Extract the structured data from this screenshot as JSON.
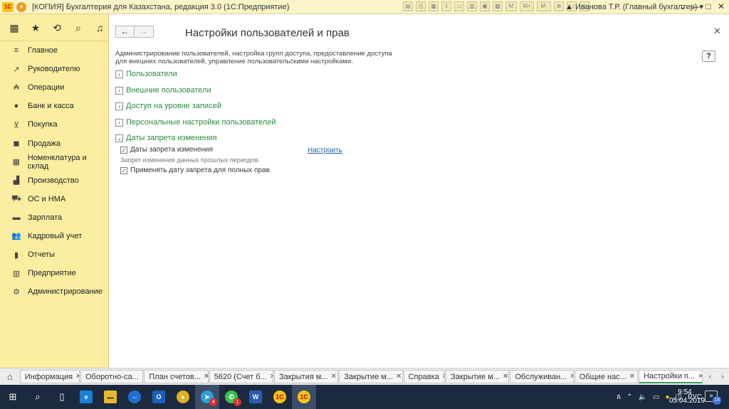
{
  "titlebar": {
    "logo": "1С",
    "title": "[КОПИЯ] Бухгалтерия для Казахстана, редакция 3.0  (1С:Предприятие)",
    "tools": [
      "M",
      "M+",
      "M-"
    ],
    "user": "Иванова Т.Р. (Главный бухгалтер)"
  },
  "sidebar": {
    "items": [
      {
        "label": "Главное",
        "icon": "menu-lines-icon"
      },
      {
        "label": "Руководителю",
        "icon": "trend-icon"
      },
      {
        "label": "Операции",
        "icon": "operations-icon"
      },
      {
        "label": "Банк и касса",
        "icon": "bank-icon"
      },
      {
        "label": "Покупка",
        "icon": "cart-icon"
      },
      {
        "label": "Продажа",
        "icon": "bag-icon"
      },
      {
        "label": "Номенклатура и склад",
        "icon": "warehouse-icon"
      },
      {
        "label": "Производство",
        "icon": "factory-icon"
      },
      {
        "label": "ОС и НМА",
        "icon": "truck-icon"
      },
      {
        "label": "Зарплата",
        "icon": "wallet-icon"
      },
      {
        "label": "Кадровый учет",
        "icon": "people-icon"
      },
      {
        "label": "Отчеты",
        "icon": "bar-chart-icon"
      },
      {
        "label": "Предприятие",
        "icon": "building-icon"
      },
      {
        "label": "Администрирование",
        "icon": "gear-icon"
      }
    ]
  },
  "main": {
    "title": "Настройки пользователей и прав",
    "help": "?",
    "description": "Администрирование пользователей, настройка групп доступа, предоставление доступа для внешних пользователей, управление пользовательскими настройками.",
    "groups": [
      {
        "label": "Пользователи",
        "expanded": false
      },
      {
        "label": "Внешние пользователи",
        "expanded": false
      },
      {
        "label": "Доступ на уровне записей",
        "expanded": false
      },
      {
        "label": "Персональные настройки пользователей",
        "expanded": false
      },
      {
        "label": "Даты запрета изменения",
        "expanded": true
      }
    ],
    "dates": {
      "checkbox1": "Даты запрета изменения",
      "link": "Настроить",
      "note": "Запрет изменения данных прошлых периодов.",
      "checkbox2": "Применять дату запрета для полных прав"
    }
  },
  "windows": {
    "tabs": [
      {
        "label": "Информация",
        "active": false
      },
      {
        "label": "Оборотно-са...",
        "active": false
      },
      {
        "label": "План счетов...",
        "active": false
      },
      {
        "label": "5620 (Счет б...",
        "active": false
      },
      {
        "label": "Закрытия м...",
        "active": false
      },
      {
        "label": "Закрытие м...",
        "active": false
      },
      {
        "label": "Справка",
        "active": false
      },
      {
        "label": "Закрытие м...",
        "active": false
      },
      {
        "label": "Обслуживан...",
        "active": false
      },
      {
        "label": "Общие нас...",
        "active": false
      },
      {
        "label": "Настройки п...",
        "active": true
      }
    ]
  },
  "taskbar": {
    "badge_telegram": "4",
    "badge_whatsapp": "1",
    "lang": "РУС",
    "time": "9:54",
    "date": "05.04.2019",
    "notifications": "13"
  }
}
